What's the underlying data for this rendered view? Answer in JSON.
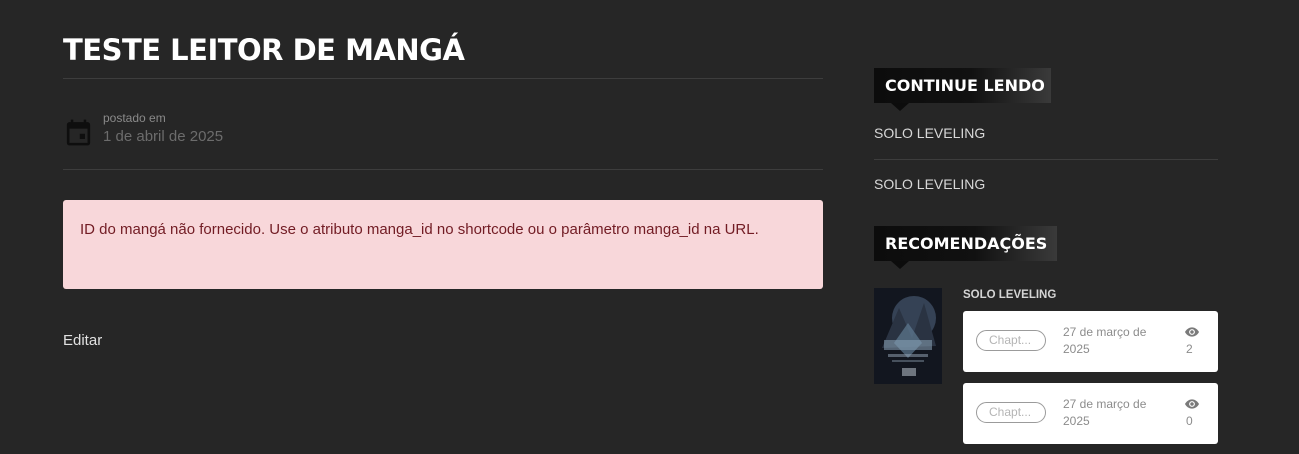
{
  "page": {
    "title": "TESTE LEITOR DE MANGÁ",
    "posted_label": "postado em",
    "posted_date": "1 de abril de 2025",
    "alert_text": "ID do mangá não fornecido. Use o atributo manga_id no shortcode ou o parâmetro manga_id na URL.",
    "edit_label": "Editar"
  },
  "sidebar": {
    "continue_title": "CONTINUE LENDO",
    "continue_items": [
      "SOLO LEVELING",
      "SOLO LEVELING"
    ],
    "recommend_title": "RECOMENDAÇÕES",
    "recommendation": {
      "title": "SOLO LEVELING",
      "chapters": [
        {
          "label": "Chapt...",
          "date": "27 de março de 2025",
          "views": "2"
        },
        {
          "label": "Chapt...",
          "date": "27 de março de 2025",
          "views": "0"
        }
      ]
    }
  },
  "colors": {
    "background": "#262626",
    "alert_bg": "#f8d7da",
    "alert_text": "#721c24",
    "widget_title_bg": "#0c0c0c"
  },
  "icons": {
    "date": "calendar-icon",
    "views": "eye-icon"
  }
}
